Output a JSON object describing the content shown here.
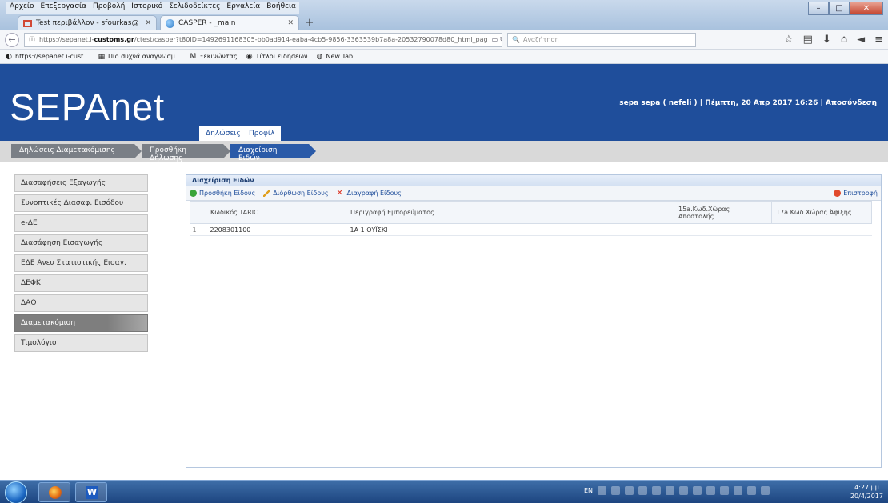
{
  "browser": {
    "menu": [
      "Αρχείο",
      "Επεξεργασία",
      "Προβολή",
      "Ιστορικό",
      "Σελιδοδείκτες",
      "Εργαλεία",
      "Βοήθεια"
    ],
    "tabs": [
      {
        "label": "Test περιβάλλον - sfourkas@",
        "icon": "gmail-icon"
      },
      {
        "label": "CASPER - _main",
        "icon": "globe-icon"
      }
    ],
    "url_prefix": "https://sepanet.i-",
    "url_domain": "customs.gr",
    "url_rest": "/ctest/casper?t80ID=1492691168305-bb0ad914-eaba-4cb5-9856-3363539b7a8a-20532790078d80_html_pag",
    "search_placeholder": "Αναζήτηση",
    "bookmarks": [
      {
        "label": "https://sepanet.i-cust...",
        "icon": "globe-icon"
      },
      {
        "label": "Πιο συχνά αναγνωσμ...",
        "icon": "page-icon"
      },
      {
        "label": "Ξεκινώντας",
        "icon": "m-icon"
      },
      {
        "label": "Τίτλοι ειδήσεων",
        "icon": "rss-icon"
      },
      {
        "label": "New Tab",
        "icon": "globe-icon"
      }
    ]
  },
  "app": {
    "logo": "SEPAnet",
    "tabs": [
      "Δηλώσεις",
      "Προφίλ"
    ],
    "user_info": "sepa sepa ( nefeli ) | Πέμπτη, 20 Απρ 2017 16:26 | Αποσύνδεση",
    "breadcrumbs": [
      "Δηλώσεις Διαμετακόμισης",
      "Προσθήκη Δήλωσης",
      "Διαχείριση Ειδών"
    ]
  },
  "sidebar": {
    "items": [
      "Διασαφήσεις Εξαγωγής",
      "Συνοπτικές Διασαφ. Εισόδου",
      "e-ΔΕ",
      "Διασάφηση Εισαγωγής",
      "ΕΔΕ Ανευ Στατιστικής Εισαγ.",
      "ΔΕΦΚ",
      "ΔΑΟ",
      "Διαμετακόμιση",
      "Τιμολόγιο"
    ],
    "active_index": 7
  },
  "panel": {
    "title": "Διαχείριση Ειδών",
    "toolbar": {
      "add": "Προσθήκη Είδους",
      "edit": "Διόρθωση Είδους",
      "delete": "Διαγραφή Είδους",
      "back": "Επιστροφή"
    },
    "columns": [
      "Κωδικός TARIC",
      "Περιγραφή Εμπορεύματος",
      "15a.Κωδ.Χώρας Αποστολής",
      "17a.Κωδ.Χώρας Άφιξης"
    ],
    "rows": [
      {
        "n": "1",
        "taric": "2208301100",
        "desc": "1A 1 ΟΥΪΣΚΙ",
        "c15": "",
        "c17": ""
      }
    ]
  },
  "taskbar": {
    "lang": "EN",
    "time": "4:27 μμ",
    "date": "20/4/2017"
  },
  "colors": {
    "brand": "#1f4e9b",
    "crumb_active": "#2a5aa8",
    "crumb": "#7a7f86"
  }
}
